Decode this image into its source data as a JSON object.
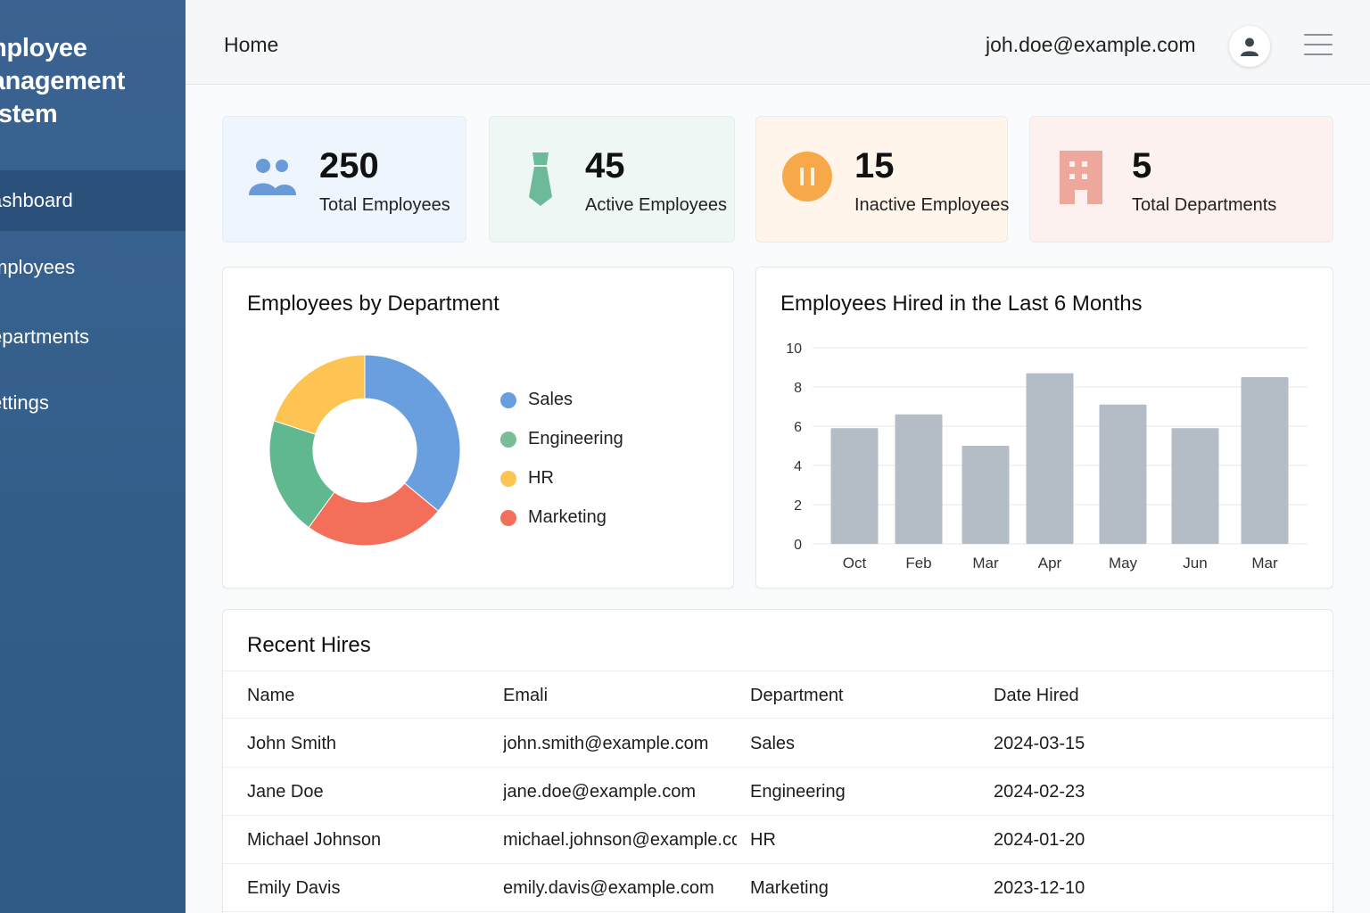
{
  "app": {
    "title_lines": [
      "mployee",
      "lanagement",
      "ystem"
    ]
  },
  "sidebar": {
    "items": [
      {
        "label": "ashboard",
        "active": true
      },
      {
        "label": "mployees"
      },
      {
        "label": "epartments"
      },
      {
        "label": "ettings"
      }
    ]
  },
  "header": {
    "title": "Home",
    "user_email": "joh.doe@example.com",
    "avatar_icon": "user-icon",
    "menu_icon": "hamburger-menu-icon"
  },
  "stats": [
    {
      "value": "250",
      "label": "Total Employees",
      "icon": "users-icon",
      "bg": "#eef5fc",
      "accent": "#6a9bd8"
    },
    {
      "value": "45",
      "label": "Active Employees",
      "icon": "tie-icon",
      "bg": "#eef7f3",
      "accent": "#6cba9a"
    },
    {
      "value": "15",
      "label": "Inactive Employees",
      "icon": "pause-icon",
      "bg": "#fff5eb",
      "accent": "#f7a94a"
    },
    {
      "value": "5",
      "label": "Total Departments",
      "icon": "building-icon",
      "bg": "#fdf1ef",
      "accent": "#eda89b"
    }
  ],
  "dept_panel": {
    "title": "Employees by Department"
  },
  "hires_panel": {
    "title": "Employees Hired in the Last 6 Months"
  },
  "chart_data": [
    {
      "type": "pie",
      "title": "Employees by Department",
      "categories": [
        "Sales",
        "Engineering",
        "HR",
        "Marketing"
      ],
      "values": [
        36,
        20,
        20,
        24
      ],
      "colors": [
        "#6a9fdf",
        "#f36f5a",
        "#5fb88e",
        "#fdc453"
      ],
      "legend_colors": {
        "Sales": "#6a9fdf",
        "Engineering": "#78bd97",
        "HR": "#fdc453",
        "Marketing": "#f36f5a"
      },
      "legend_position": "right",
      "donut": true
    },
    {
      "type": "bar",
      "title": "Employees Hired in the Last 6 Months",
      "categories": [
        "Oct",
        "Feb",
        "Mar",
        "Apr",
        "May",
        "Jun",
        "Mar"
      ],
      "values": [
        5.9,
        6.6,
        5.0,
        8.7,
        7.1,
        5.9,
        8.5
      ],
      "ylim": [
        0,
        10
      ],
      "yticks": [
        0,
        2,
        4,
        6,
        8,
        10
      ],
      "grid": true,
      "bar_color": "#b4bcc6"
    }
  ],
  "recent_hires": {
    "title": "Recent Hires",
    "columns": [
      "Name",
      "Emali",
      "Department",
      "Date Hired"
    ],
    "rows": [
      [
        "John Smith",
        "john.smith@example.com",
        "Sales",
        "2024-03-15"
      ],
      [
        "Jane Doe",
        "jane.doe@example.com",
        "Engineering",
        "2024-02-23"
      ],
      [
        "Michael Johnson",
        "michael.johnson@example.com",
        "HR",
        "2024-01-20"
      ],
      [
        "Emily Davis",
        "emily.davis@example.com",
        "Marketing",
        "2023-12-10"
      ]
    ]
  }
}
